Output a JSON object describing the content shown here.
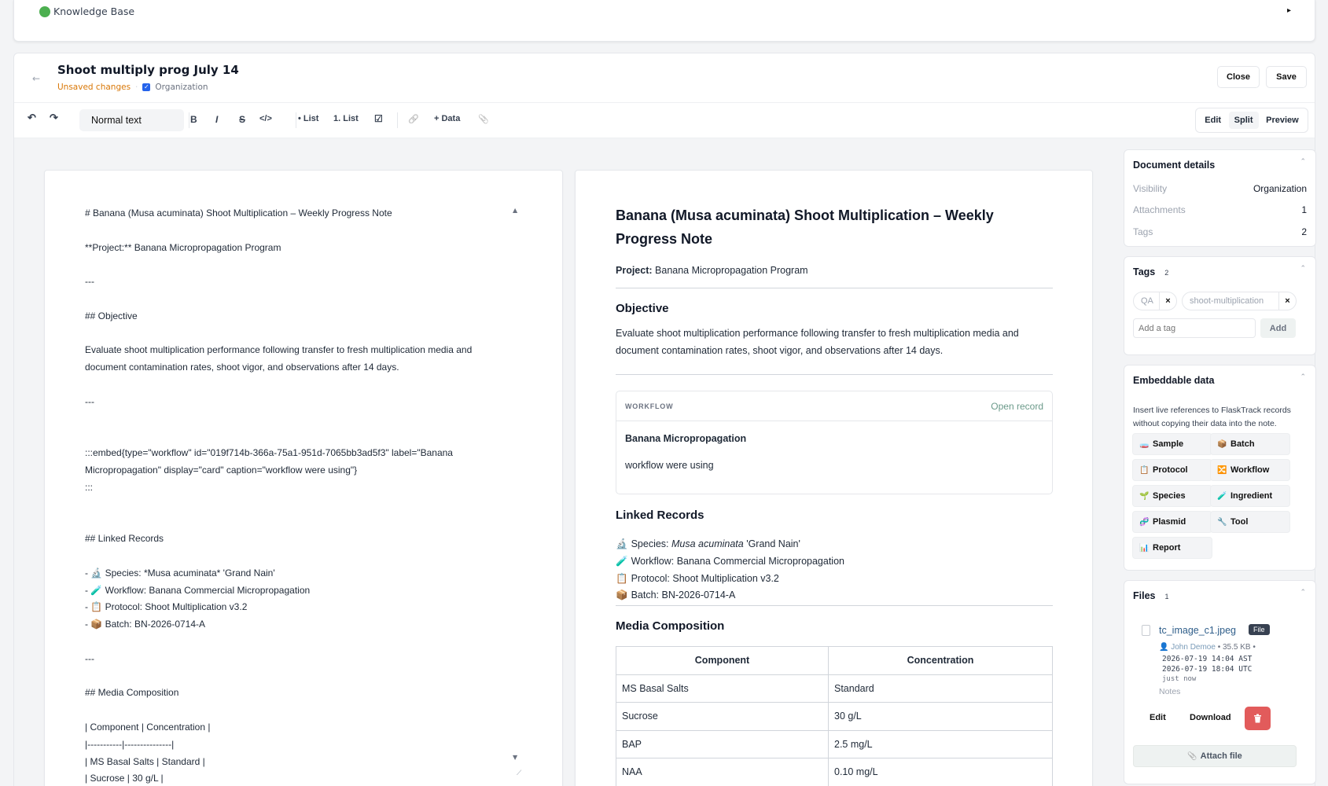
{
  "topbar": {
    "label": "Knowledge Base",
    "expand_glyph": "▸"
  },
  "header": {
    "back_glyph": "←",
    "title": "Shoot multiply prog July 14",
    "unsaved": "Unsaved changes",
    "separator": "·",
    "visibility": "Organization",
    "close_label": "Close",
    "save_label": "Save"
  },
  "toolbar": {
    "undo": "↶",
    "redo": "↷",
    "block_type": "Normal text",
    "bold": "B",
    "italic": "I",
    "strike": "S",
    "code": "</>",
    "bullet_list": "• List",
    "numbered_list": "1. List",
    "checklist": "☑",
    "link": "🔗",
    "data": "+ Data",
    "attach": "📎",
    "view_modes": [
      "Edit",
      "Split",
      "Preview"
    ],
    "active_view": "Split"
  },
  "markdown": {
    "lines": [
      "# Banana (Musa acuminata) Shoot Multiplication – Weekly Progress Note",
      "",
      "**Project:** Banana Micropropagation Program",
      "",
      "---",
      "",
      "## Objective",
      "",
      "Evaluate shoot multiplication performance following transfer to fresh multiplication media and",
      "document contamination rates, shoot vigor, and observations after 14 days.",
      "",
      "---",
      "",
      "",
      ":::embed{type=\"workflow\" id=\"019f714b-366a-75a1-951d-7065bb3ad5f3\" label=\"Banana",
      "Micropropagation\" display=\"card\" caption=\"workflow were using\"}",
      ":::",
      "",
      "",
      "## Linked Records",
      "",
      "- 🔬 Species: *Musa acuminata* 'Grand Nain'",
      "- 🧪 Workflow: Banana Commercial Micropropagation",
      "- 📋 Protocol: Shoot Multiplication v3.2",
      "- 📦 Batch: BN-2026-0714-A",
      "",
      "---",
      "",
      "## Media Composition",
      "",
      "| Component | Concentration |",
      "|-----------|---------------|",
      "| MS Basal Salts | Standard |",
      "| Sucrose | 30 g/L |"
    ]
  },
  "preview": {
    "title": "Banana (Musa acuminata) Shoot Multiplication – Weekly Progress Note",
    "project_label": "Project:",
    "project_value": "Banana Micropropagation Program",
    "objective_heading": "Objective",
    "objective_text": "Evaluate shoot multiplication performance following transfer to fresh multiplication media and document contamination rates, shoot vigor, and observations after 14 days.",
    "embed": {
      "type_label": "WORKFLOW",
      "open_label": "Open record",
      "name": "Banana Micropropagation",
      "caption": "workflow were using"
    },
    "linked_heading": "Linked Records",
    "linked": [
      {
        "icon": "🔬",
        "label": "Species: ",
        "italic": "Musa acuminata",
        "rest": " 'Grand Nain'"
      },
      {
        "icon": "🧪",
        "label": "Workflow: Banana Commercial Micropropagation",
        "italic": "",
        "rest": ""
      },
      {
        "icon": "📋",
        "label": "Protocol: Shoot Multiplication v3.2",
        "italic": "",
        "rest": ""
      },
      {
        "icon": "📦",
        "label": "Batch: BN-2026-0714-A",
        "italic": "",
        "rest": ""
      }
    ],
    "media_heading": "Media Composition",
    "table": {
      "headers": [
        "Component",
        "Concentration"
      ],
      "rows": [
        [
          "MS Basal Salts",
          "Standard"
        ],
        [
          "Sucrose",
          "30 g/L"
        ],
        [
          "BAP",
          "2.5 mg/L"
        ],
        [
          "NAA",
          "0.10 mg/L"
        ]
      ]
    }
  },
  "sidebar": {
    "details": {
      "title": "Document details",
      "rows": [
        {
          "key": "Visibility",
          "value": "Organization"
        },
        {
          "key": "Attachments",
          "value": "1"
        },
        {
          "key": "Tags",
          "value": "2"
        }
      ]
    },
    "tags": {
      "title": "Tags",
      "count": "2",
      "items": [
        "QA",
        "shoot-multiplication"
      ],
      "remove_glyph": "×",
      "input_placeholder": "Add a tag",
      "add_label": "Add"
    },
    "embeddable": {
      "title": "Embeddable data",
      "description": "Insert live references to FlaskTrack records without copying their data into the note.",
      "buttons": [
        {
          "icon": "🧫",
          "label": "Sample"
        },
        {
          "icon": "📦",
          "label": "Batch"
        },
        {
          "icon": "📋",
          "label": "Protocol"
        },
        {
          "icon": "🔀",
          "label": "Workflow"
        },
        {
          "icon": "🌱",
          "label": "Species"
        },
        {
          "icon": "🧪",
          "label": "Ingredient"
        },
        {
          "icon": "🧬",
          "label": "Plasmid"
        },
        {
          "icon": "🔧",
          "label": "Tool"
        },
        {
          "icon": "📊",
          "label": "Report"
        }
      ]
    },
    "files": {
      "title": "Files",
      "count": "1",
      "file_name": "tc_image_c1.jpeg",
      "badge": "File",
      "user": "John Demoe",
      "size": "• 35.5 KB •",
      "time_local": "2026-07-19 14:04 AST",
      "time_utc": "2026-07-19 18:04 UTC",
      "relative": "just now",
      "notes_label": "Notes",
      "edit_label": "Edit",
      "download_label": "Download",
      "attach_label": "Attach file"
    }
  },
  "colors": {
    "accent_open": "#6b9a8a",
    "unsaved": "#d97706",
    "delete": "#e25b5b",
    "file_link": "#2f5e8a"
  }
}
